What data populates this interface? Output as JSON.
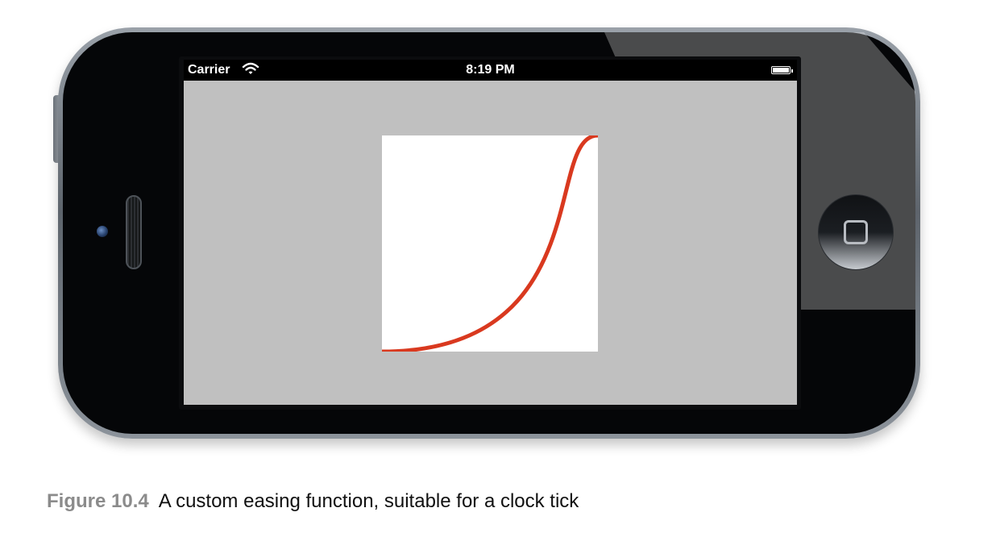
{
  "status_bar": {
    "carrier": "Carrier",
    "time": "8:19 PM",
    "wifi_icon": "wifi-icon",
    "battery_icon": "battery-icon",
    "battery_level": 1.0
  },
  "curve": {
    "color": "#d9391f",
    "control_point_1": [
      1,
      0
    ],
    "control_point_2": [
      0.75,
      1
    ]
  },
  "screen_background": "#c0c0c0",
  "caption": {
    "number": "Figure 10.4",
    "text": "A custom easing function, suitable for a clock tick"
  }
}
